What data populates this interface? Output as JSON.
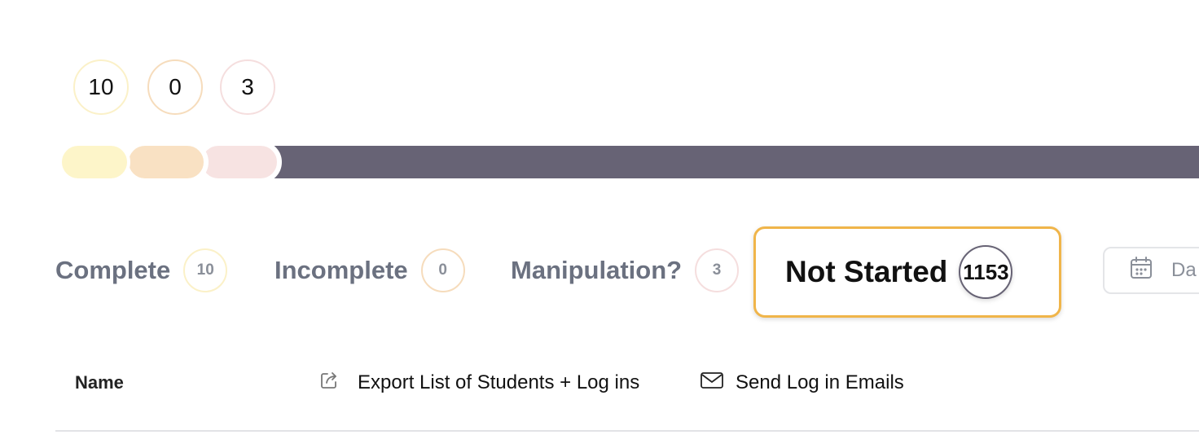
{
  "summary_counts": [
    {
      "value": "10",
      "color": "#fbf1c8"
    },
    {
      "value": "0",
      "color": "#f6dcbc"
    },
    {
      "value": "3",
      "color": "#f5dede"
    }
  ],
  "progress_bar": {
    "segments": [
      {
        "status": "complete",
        "count": 10,
        "color": "#fdf5c9"
      },
      {
        "status": "incomplete",
        "count": 0,
        "color": "#f9e1c3"
      },
      {
        "status": "manipulation",
        "count": 3,
        "color": "#f7e3e2"
      }
    ],
    "remaining": {
      "status": "not_started",
      "count": 1153,
      "color": "#676375"
    }
  },
  "tabs": [
    {
      "label": "Complete",
      "count": "10"
    },
    {
      "label": "Incomplete",
      "count": "0"
    },
    {
      "label": "Manipulation?",
      "count": "3"
    },
    {
      "label": "Not Started",
      "count": "1153",
      "active": true
    }
  ],
  "date_filter": {
    "label": "Da",
    "icon": "calendar-icon"
  },
  "toolbar": {
    "name_header": "Name",
    "export_label": "Export List of Students + Log ins",
    "export_icon": "external-link-icon",
    "email_label": "Send Log in Emails",
    "email_icon": "envelope-icon"
  },
  "colors": {
    "accent_highlight": "#f0b54a",
    "track": "#676375",
    "muted_text": "#6b7180"
  }
}
